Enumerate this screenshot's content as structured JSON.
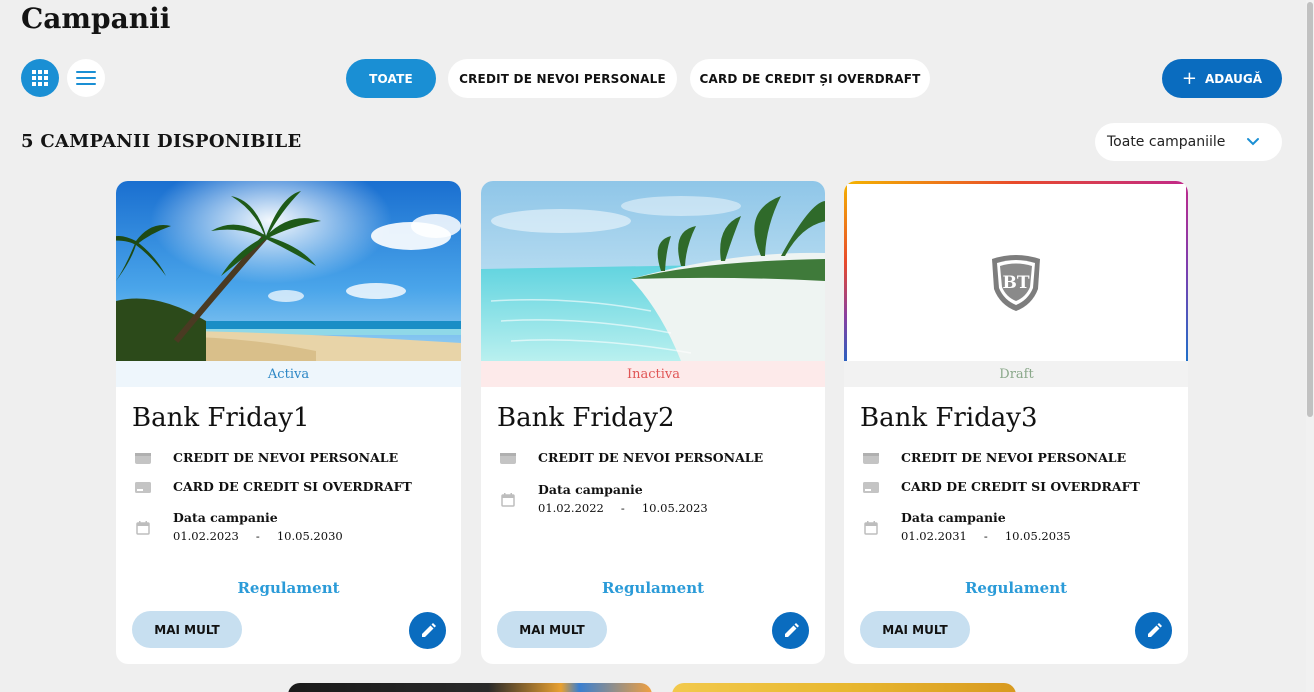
{
  "page": {
    "title": "Campanii"
  },
  "view_toggle": {
    "grid_icon": "grid-icon",
    "list_icon": "list-icon"
  },
  "filters": [
    {
      "label": "TOATE",
      "active": true
    },
    {
      "label": "CREDIT DE NEVOI PERSONALE",
      "active": false
    },
    {
      "label": "CARD DE CREDIT ȘI OVERDRAFT",
      "active": false
    }
  ],
  "add_button": {
    "label": "ADAUGĂ",
    "icon": "plus-icon"
  },
  "summary": {
    "count_label": "5 CAMPANII DISPONIBILE"
  },
  "status_filter": {
    "value": "Toate campaniile",
    "icon": "chevron-down-icon"
  },
  "cards": [
    {
      "title": "Bank Friday1",
      "status": "Activa",
      "status_color": "#2b86c5",
      "status_bg": "#eef6fc",
      "image": "tropical-beach-palm",
      "products": [
        "CREDIT DE NEVOI PERSONALE",
        "CARD DE CREDIT SI OVERDRAFT"
      ],
      "date_label": "Data campanie",
      "date_start": "01.02.2023",
      "date_sep": "-",
      "date_end": "10.05.2030",
      "rules_link": "Regulament",
      "more_label": "MAI MULT"
    },
    {
      "title": "Bank Friday2",
      "status": "Inactiva",
      "status_color": "#e05555",
      "status_bg": "#fdeaea",
      "image": "turquoise-lagoon-palms",
      "products": [
        "CREDIT DE NEVOI PERSONALE"
      ],
      "date_label": "Data campanie",
      "date_start": "01.02.2022",
      "date_sep": "-",
      "date_end": "10.05.2023",
      "rules_link": "Regulament",
      "more_label": "MAI MULT"
    },
    {
      "title": "Bank Friday3",
      "status": "Draft",
      "status_color": "#8aa88a",
      "status_bg": "#f2f2f2",
      "image": "bt-logo-placeholder",
      "logo_text": "BT",
      "products": [
        "CREDIT DE NEVOI PERSONALE",
        "CARD DE CREDIT SI OVERDRAFT"
      ],
      "date_label": "Data campanie",
      "date_start": "01.02.2031",
      "date_sep": "-",
      "date_end": "10.05.2035",
      "rules_link": "Regulament",
      "more_label": "MAI MULT"
    }
  ],
  "icons": {
    "product": "wallet-icon",
    "card": "credit-card-icon",
    "calendar": "calendar-icon",
    "edit": "pencil-icon"
  }
}
